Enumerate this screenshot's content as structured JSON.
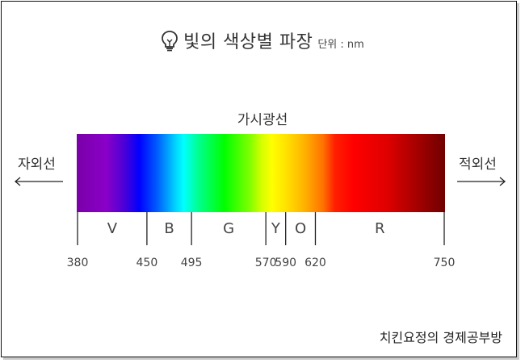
{
  "title": "빛의 색상별 파장",
  "unit": "단위 : nm",
  "visible_label": "가시광선",
  "ultraviolet_label": "자외선",
  "infrared_label": "적외선",
  "footer": "치킨요정의 경제공부방",
  "icons": {
    "title": "light-bulb-icon"
  },
  "colors": {
    "text": "#333333",
    "border": "#111111"
  },
  "spectrum": {
    "min": 380,
    "max": 750,
    "bands": [
      {
        "letter": "V",
        "start": 380,
        "end": 450
      },
      {
        "letter": "B",
        "start": 450,
        "end": 495
      },
      {
        "letter": "G",
        "start": 495,
        "end": 570
      },
      {
        "letter": "Y",
        "start": 570,
        "end": 590
      },
      {
        "letter": "O",
        "start": 590,
        "end": 620
      },
      {
        "letter": "R",
        "start": 620,
        "end": 750
      }
    ],
    "ticks": [
      "380",
      "450",
      "495",
      "570",
      "590",
      "620",
      "750"
    ]
  }
}
